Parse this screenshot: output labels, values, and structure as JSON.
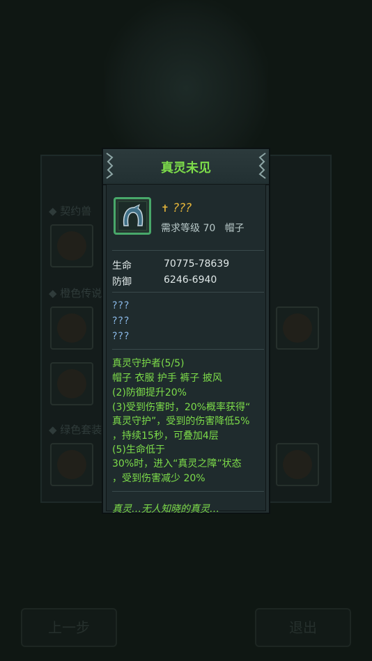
{
  "background": {
    "sections": [
      "◆ 契约兽",
      "◆ 橙色传说",
      "◆ 绿色套装"
    ],
    "buttons": {
      "prev": "上一步",
      "exit": "退出"
    }
  },
  "popup": {
    "title": "真灵未见",
    "item": {
      "name": "???",
      "requirement": "需求等级 70",
      "slot": "帽子",
      "icon": "hood-icon",
      "rarity_color": "#48a86a"
    },
    "stats": [
      {
        "label": "生命",
        "value": "70775-78639"
      },
      {
        "label": "防御",
        "value": "6246-6940"
      }
    ],
    "hidden_attributes": [
      "???",
      "???",
      "???"
    ],
    "set": {
      "lines": [
        "真灵守护者(5/5)",
        "帽子 衣服 护手 裤子 披风",
        "(2)防御提升20%",
        "(3)受到伤害时，20%概率获得“",
        "真灵守护”，受到的伤害降低5%",
        "，持续15秒，可叠加4层",
        "(5)生命低于",
        "30%时，进入“真灵之障”状态",
        "，受到伤害减少 20%"
      ]
    },
    "flavor": "真灵…无人知晓的真灵…"
  },
  "colors": {
    "title_green": "#7ddc4a",
    "unknown_gold": "#e3b43a",
    "hidden_blue": "#8ab8e6"
  }
}
